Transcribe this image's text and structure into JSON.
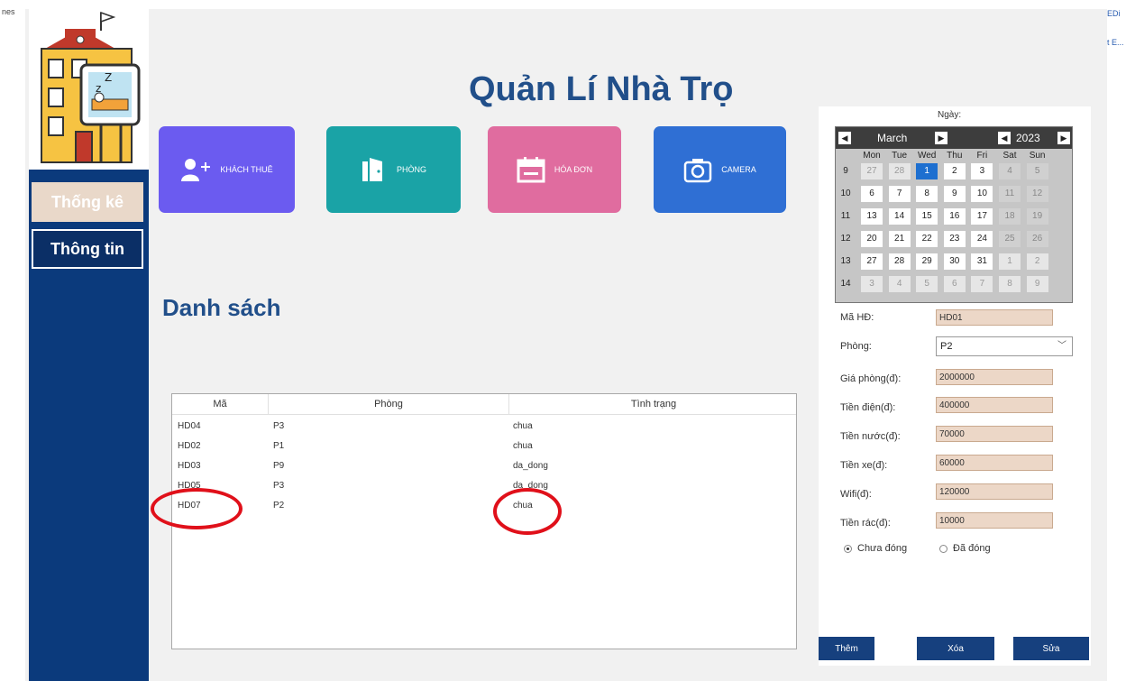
{
  "window": {
    "left_fragment": "nes",
    "right_fragments": [
      "EDi",
      "t E..."
    ]
  },
  "app": {
    "title": "Quản Lí Nhà Trọ"
  },
  "sidebar": {
    "items": [
      {
        "label": "Thống kê"
      },
      {
        "label": "Thông tin"
      }
    ]
  },
  "tiles": [
    {
      "label": "KHÁCH THUÊ",
      "icon": "add-user-icon",
      "color": "#6b5bf0"
    },
    {
      "label": "PHÒNG",
      "icon": "door-icon",
      "color": "#1aa3a6"
    },
    {
      "label": "HÓA ĐƠN",
      "icon": "calendar-icon",
      "color": "#e06c9f"
    },
    {
      "label": "CAMERA",
      "icon": "camera-icon",
      "color": "#2f6fd4"
    }
  ],
  "list": {
    "title": "Danh sách",
    "columns": [
      "Mã",
      "Phòng",
      "Tình trạng"
    ],
    "rows": [
      {
        "ma": "HD04",
        "phong": "P3",
        "tinh_trang": "chua"
      },
      {
        "ma": "HD02",
        "phong": "P1",
        "tinh_trang": "chua"
      },
      {
        "ma": "HD03",
        "phong": "P9",
        "tinh_trang": "da_dong"
      },
      {
        "ma": "HD05",
        "phong": "P3",
        "tinh_trang": "da_dong"
      },
      {
        "ma": "HD07",
        "phong": "P2",
        "tinh_trang": "chua"
      }
    ]
  },
  "calendar": {
    "caption": "Ngày:",
    "month": "March",
    "year": "2023",
    "days_of_week": [
      "Mon",
      "Tue",
      "Wed",
      "Thu",
      "Fri",
      "Sat",
      "Sun"
    ],
    "weeks": [
      {
        "num": "9",
        "days": [
          "27",
          "28",
          "1",
          "2",
          "3",
          "4",
          "5"
        ]
      },
      {
        "num": "10",
        "days": [
          "6",
          "7",
          "8",
          "9",
          "10",
          "11",
          "12"
        ]
      },
      {
        "num": "11",
        "days": [
          "13",
          "14",
          "15",
          "16",
          "17",
          "18",
          "19"
        ]
      },
      {
        "num": "12",
        "days": [
          "20",
          "21",
          "22",
          "23",
          "24",
          "25",
          "26"
        ]
      },
      {
        "num": "13",
        "days": [
          "27",
          "28",
          "29",
          "30",
          "31",
          "1",
          "2"
        ]
      },
      {
        "num": "14",
        "days": [
          "3",
          "4",
          "5",
          "6",
          "7",
          "8",
          "9"
        ]
      }
    ],
    "selected": "1"
  },
  "form": {
    "ma_hd": {
      "label": "Mã HĐ:",
      "value": "HD01"
    },
    "phong": {
      "label": "Phòng:",
      "value": "P2"
    },
    "gia_phong": {
      "label": "Giá phòng(đ):",
      "value": "2000000"
    },
    "tien_dien": {
      "label": "Tiền điện(đ):",
      "value": "400000"
    },
    "tien_nuoc": {
      "label": "Tiền nước(đ):",
      "value": "70000"
    },
    "tien_xe": {
      "label": "Tiền xe(đ):",
      "value": "60000"
    },
    "wifi": {
      "label": "Wifi(đ):",
      "value": "120000"
    },
    "tien_rac": {
      "label": "Tiền rác(đ):",
      "value": "10000"
    },
    "radio": {
      "chua_dong": "Chưa đóng",
      "da_dong": "Đã đóng",
      "selected": "chua_dong"
    }
  },
  "actions": {
    "add": "Thêm",
    "delete": "Xóa",
    "edit": "Sửa"
  },
  "colors": {
    "sidebar": "#0b3a7c",
    "title": "#214f8a",
    "button": "#16407e",
    "annotation": "#e0101a"
  }
}
